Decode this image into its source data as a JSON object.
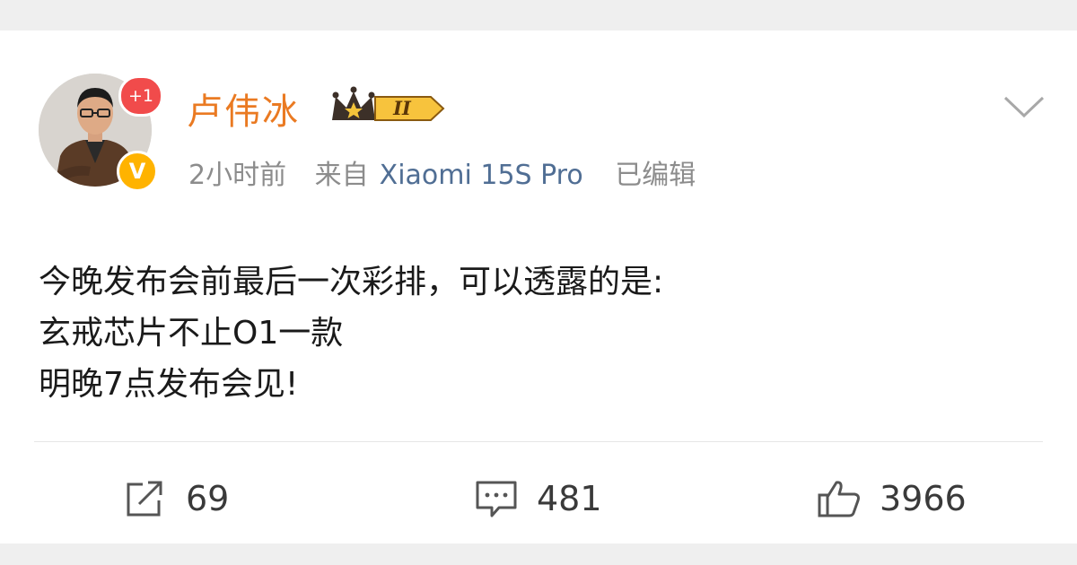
{
  "post": {
    "author": {
      "name": "卢伟冰",
      "notification_badge": "+1",
      "verified_badge": "V"
    },
    "vip_badge": {
      "level": "II"
    },
    "meta": {
      "time": "2小时前",
      "source_prefix": "来自",
      "device": "Xiaomi 15S Pro",
      "edited": "已编辑"
    },
    "content_lines": [
      "今晚发布会前最后一次彩排，可以透露的是:",
      "玄戒芯片不止O1一款",
      "明晚7点发布会见!"
    ],
    "actions": {
      "reposts": "69",
      "comments": "481",
      "likes": "3966"
    },
    "icons": {
      "repost": "repost-icon",
      "comment": "comment-icon",
      "like": "thumbs-up-icon",
      "more": "chevron-down-icon"
    },
    "colors": {
      "username": "#ea7a22",
      "device_link": "#506e94",
      "notification_badge": "#f14b4b",
      "verified_badge": "#ffb300"
    }
  }
}
